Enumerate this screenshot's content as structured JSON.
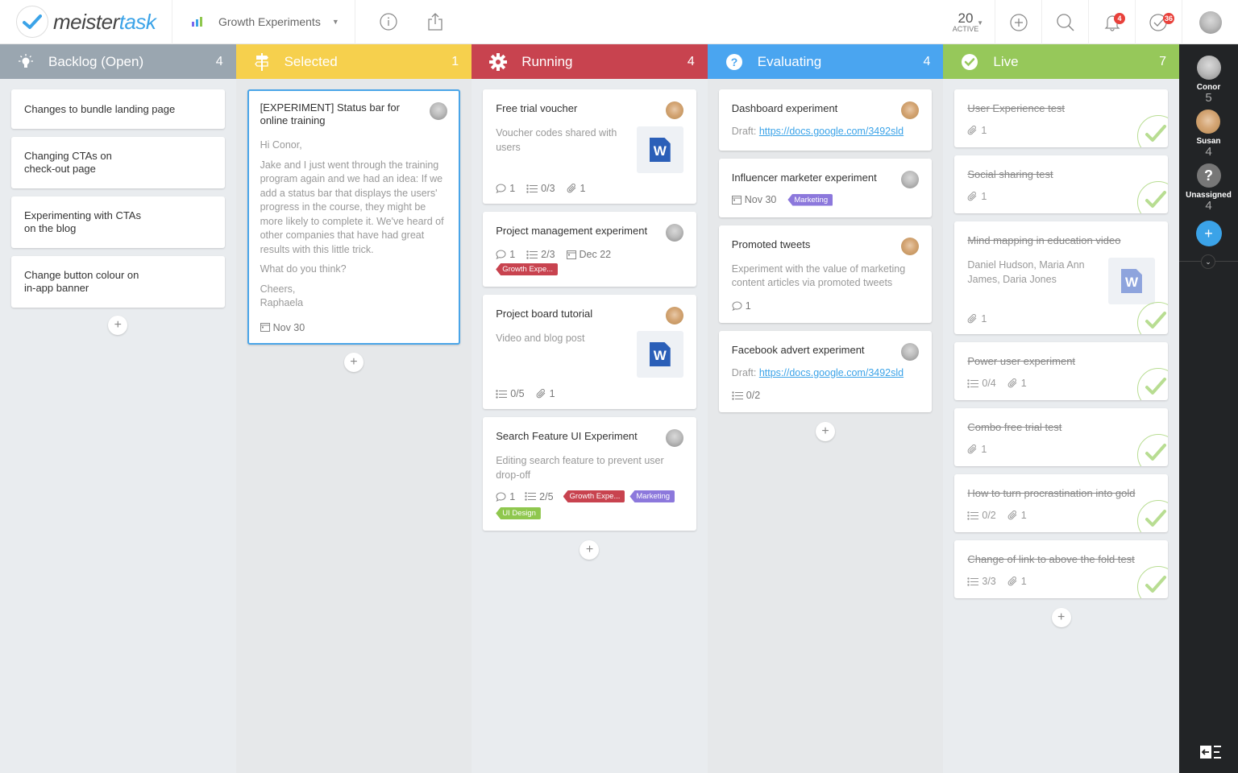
{
  "app": {
    "logo_main": "meister",
    "logo_accent": "task"
  },
  "header": {
    "project_name": "Growth Experiments",
    "active_count": "20",
    "active_label": "ACTIVE",
    "notifications_badge": "4",
    "tasks_badge": "36",
    "colors": {
      "accent": "#3ba3e8",
      "badge": "#e8413b"
    }
  },
  "columns": [
    {
      "title": "Backlog (Open)",
      "count": "4",
      "color": "#9aa6b0",
      "icon": "lightbulb-icon",
      "cards": [
        {
          "title": "Changes to bundle landing page"
        },
        {
          "title": "Changing CTAs on check-out page"
        },
        {
          "title": "Experimenting with CTAs on the blog"
        },
        {
          "title": "Change button colour on in-app banner"
        }
      ]
    },
    {
      "title": "Selected",
      "count": "1",
      "color": "#f6d04d",
      "icon": "signpost-icon",
      "cards": [
        {
          "title": "[EXPERIMENT] Status bar for online training",
          "body": [
            "Hi Conor,",
            "Jake and I just went through the training program again and we had an idea: If we add a status bar that displays the users' progress in the course, they might be more likely to complete it. We've heard of other companies that have had great results with this little trick.",
            "What do you think?",
            "Cheers, Raphaela"
          ],
          "due": "Nov 30",
          "assignee": "Conor"
        }
      ]
    },
    {
      "title": "Running",
      "count": "4",
      "color": "#c8434f",
      "icon": "gear-icon",
      "cards": [
        {
          "title": "Free trial voucher",
          "desc": "Voucher codes shared with users",
          "comments": "1",
          "checklist": "0/3",
          "attachments": "1",
          "assignee": "Susan"
        },
        {
          "title": "Project management experiment",
          "comments": "1",
          "checklist": "2/3",
          "due": "Dec 22",
          "tags": [
            "Growth Expe..."
          ],
          "assignee": "Conor"
        },
        {
          "title": "Project board tutorial",
          "desc": "Video and blog post",
          "checklist": "0/5",
          "attachments": "1",
          "assignee": "Susan"
        },
        {
          "title": "Search Feature UI Experiment",
          "desc": "Editing search feature to prevent user drop-off",
          "comments": "1",
          "checklist": "2/5",
          "tags": [
            "Growth Expe...",
            "Marketing",
            "UI Design"
          ],
          "assignee": "Conor"
        }
      ]
    },
    {
      "title": "Evaluating",
      "count": "4",
      "color": "#4aa5f0",
      "icon": "question-icon",
      "cards": [
        {
          "title": "Dashboard experiment",
          "desc_prefix": "Draft: ",
          "link": "https://docs.google.com/3492sld",
          "assignee": "Susan"
        },
        {
          "title": "Influencer marketer experiment",
          "due": "Nov 30",
          "tags": [
            "Marketing"
          ],
          "assignee": "Conor"
        },
        {
          "title": "Promoted tweets",
          "desc": "Experiment with the value of marketing content articles via promoted tweets",
          "comments": "1",
          "assignee": "Susan"
        },
        {
          "title": "Facebook advert experiment",
          "desc_prefix": "Draft: ",
          "link": "https://docs.google.com/3492sld",
          "checklist": "0/2",
          "assignee": "Conor"
        }
      ]
    },
    {
      "title": "Live",
      "count": "7",
      "color": "#96c85a",
      "icon": "check-circle-icon",
      "cards": [
        {
          "title": "User Experience test",
          "attachments": "1"
        },
        {
          "title": "Social sharing test",
          "attachments": "1"
        },
        {
          "title": "Mind mapping in education video",
          "desc": "Daniel Hudson, Maria Ann James, Daria Jones",
          "attachments": "1"
        },
        {
          "title": "Power user experiment",
          "checklist": "0/4",
          "attachments": "1"
        },
        {
          "title": "Combo free trial test",
          "attachments": "1"
        },
        {
          "title": "How to turn procrastination into gold",
          "checklist": "0/2",
          "attachments": "1"
        },
        {
          "title": "Change of link to above the fold test",
          "checklist": "3/3",
          "attachments": "1"
        }
      ]
    }
  ],
  "sidebar": {
    "users": [
      {
        "name": "Conor",
        "count": "5"
      },
      {
        "name": "Susan",
        "count": "4"
      },
      {
        "name": "Unassigned",
        "count": "4"
      }
    ],
    "add_label": "+",
    "unassigned_glyph": "?"
  },
  "common": {
    "add_card": "+"
  }
}
